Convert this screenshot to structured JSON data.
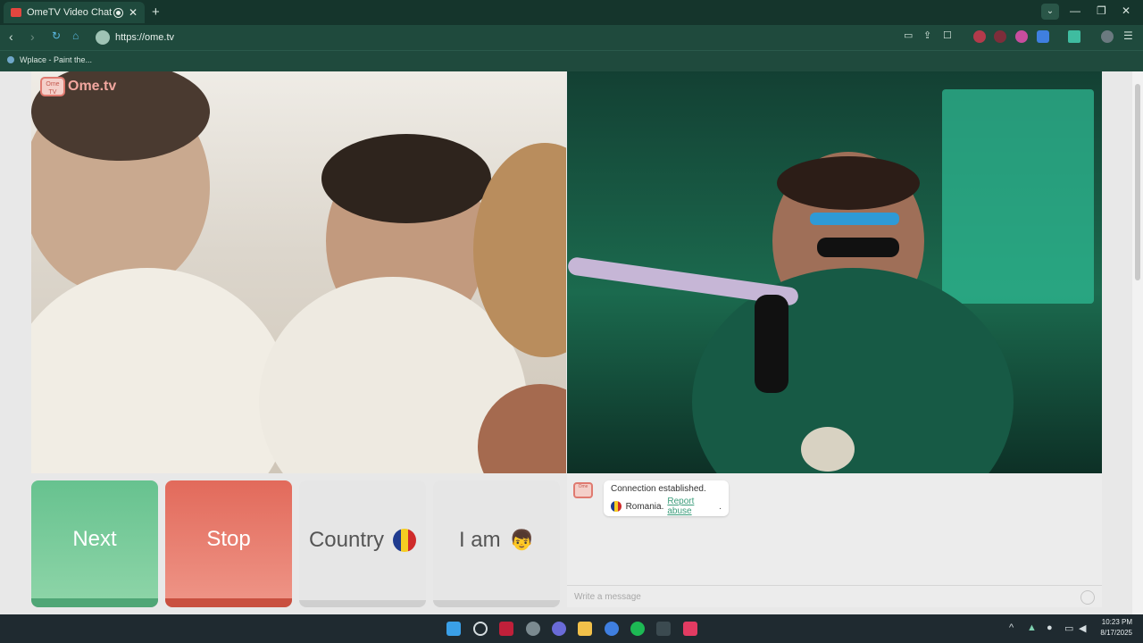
{
  "browser": {
    "tab_title": "OmeTV Video Chat — Ome",
    "tab_close": "✕",
    "new_tab": "+",
    "url": "https://ome.tv",
    "bookmark": "Wplace - Paint the..."
  },
  "page": {
    "logo_text": "Ome.tv",
    "logo_badge": "Ome TV",
    "buttons": {
      "next": "Next",
      "stop": "Stop",
      "country": "Country",
      "iam": "I am"
    },
    "chat": {
      "message_line1": "Connection established.",
      "country": "Romania.",
      "report": "Report abuse",
      "report_suffix": ".",
      "input_placeholder": "Write a message"
    }
  },
  "taskbar": {
    "time": "10:23 PM",
    "date": "8/17/2025"
  },
  "colors": {
    "next": "#67c28f",
    "stop": "#e26a5b",
    "flag_blue": "#1f3b8f",
    "flag_yellow": "#f5cc22",
    "flag_red": "#cf2b2b"
  }
}
